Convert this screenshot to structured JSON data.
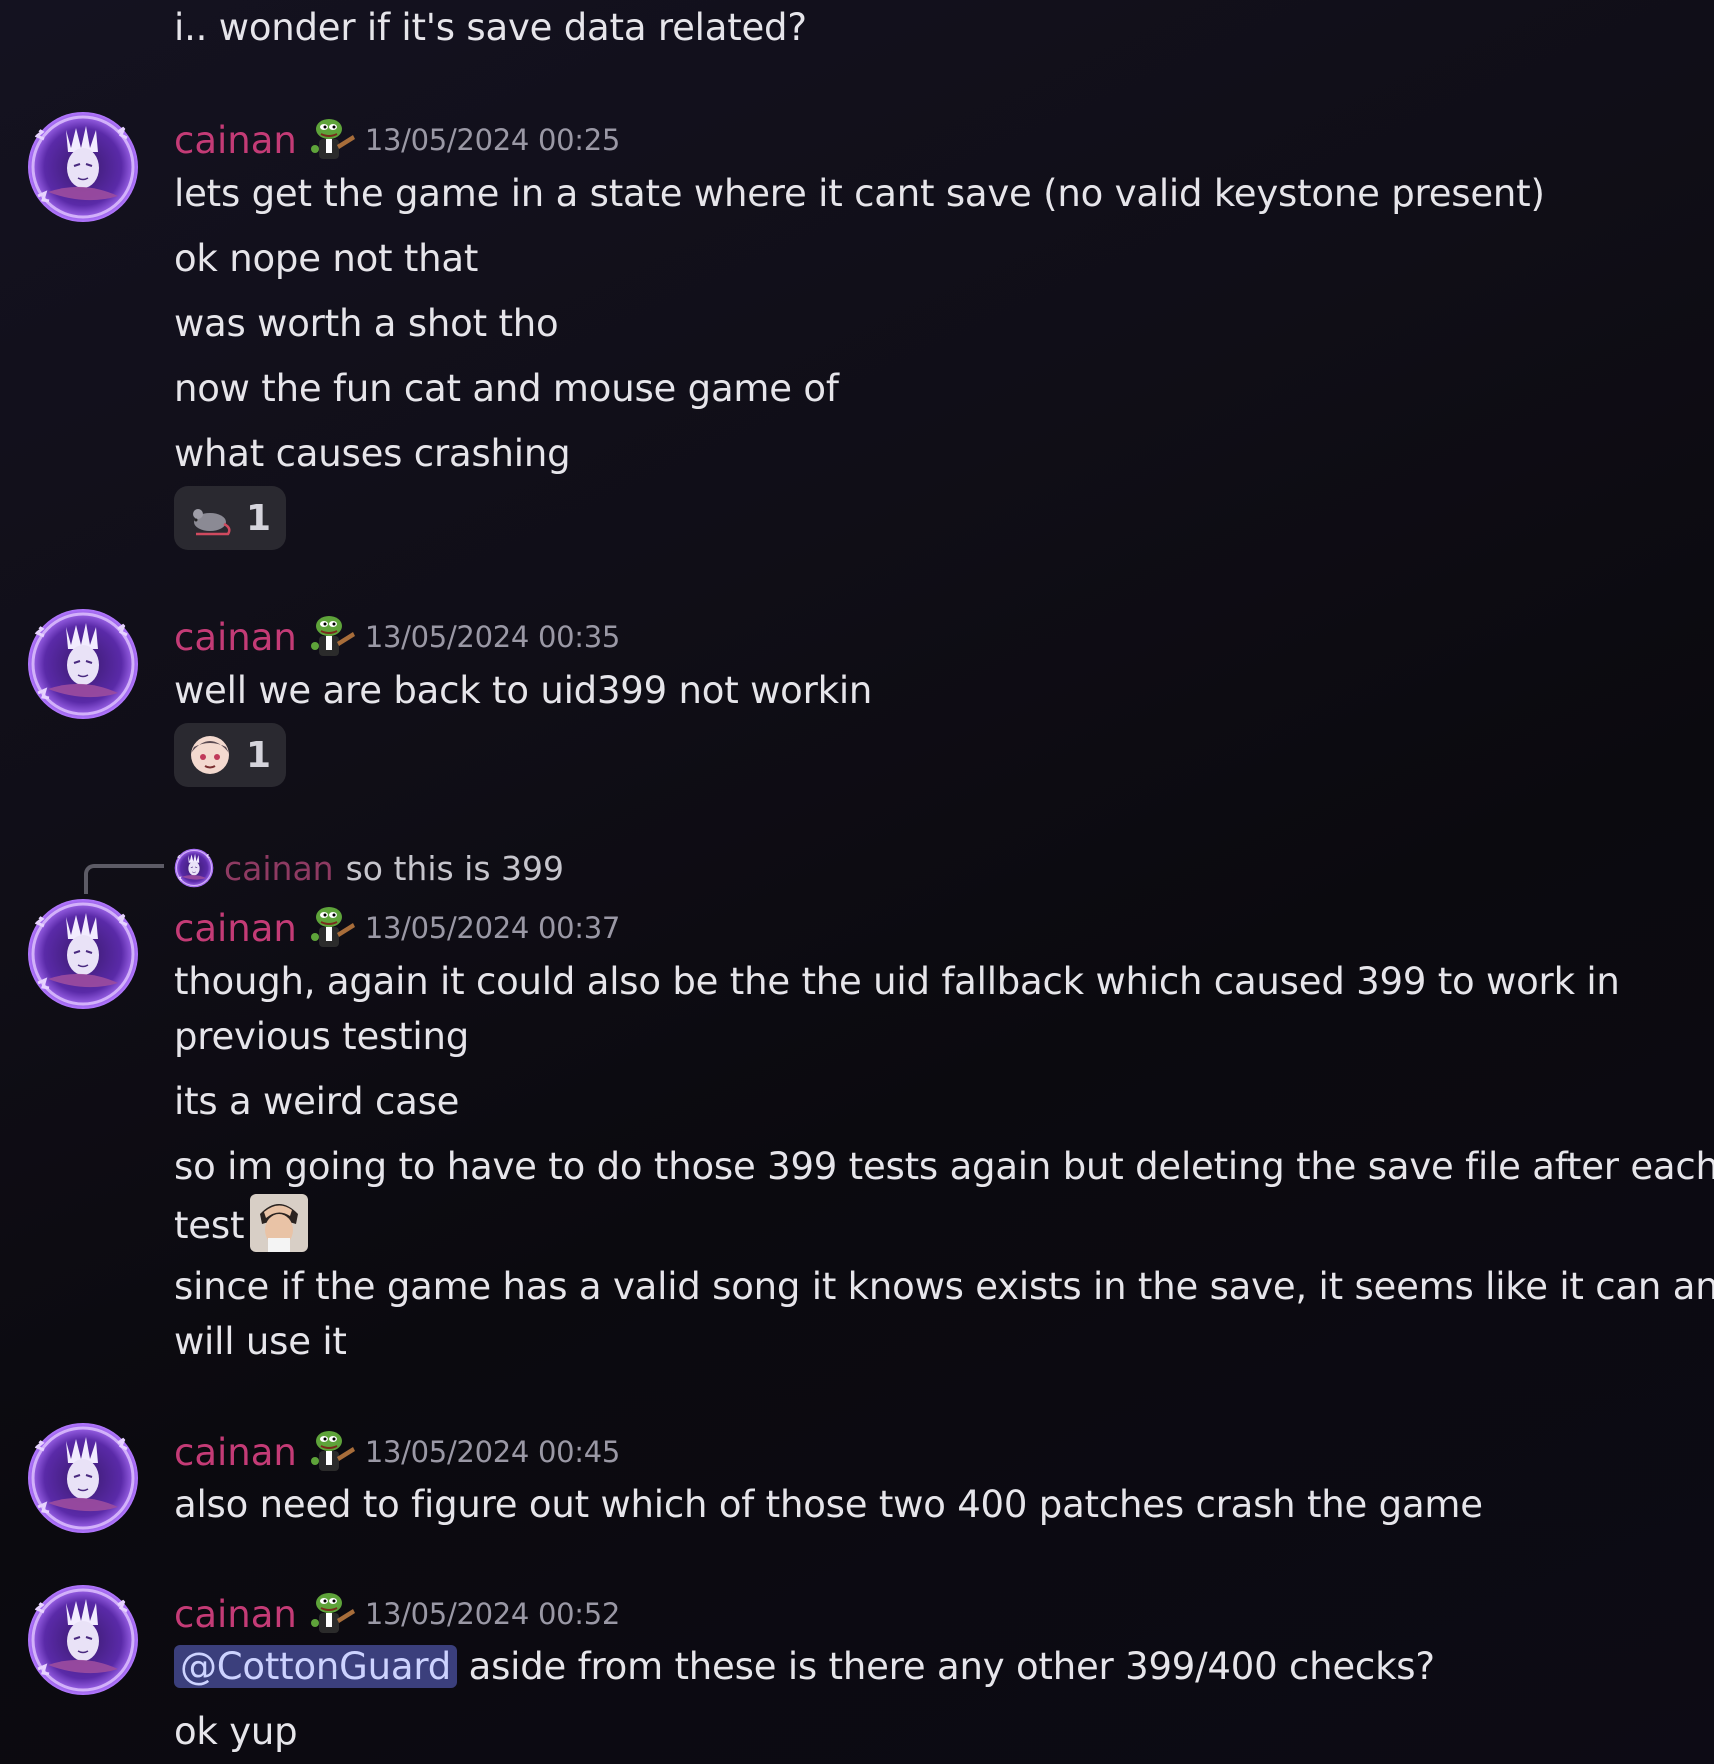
{
  "colors": {
    "background": "#0c0b10",
    "username": "#c43b76",
    "timestamp": "#9a98a5",
    "text": "#e6e5ea",
    "reaction_bg": "#2a2930",
    "mention_bg": "#3b3f7c"
  },
  "top_line": "i.. wonder if it's save data related?",
  "groups": [
    {
      "username": "cainan",
      "timestamp": "13/05/2024 00:25",
      "badge_icon": "pepe-role-badge-icon",
      "lines": [
        "lets get the game in a state where it cant save (no valid keystone present)",
        "ok nope not that",
        "was worth a shot tho",
        "now the fun cat and mouse game of",
        "what causes crashing"
      ],
      "reaction": {
        "emoji": "mouse-icon",
        "count": "1"
      }
    },
    {
      "username": "cainan",
      "timestamp": "13/05/2024 00:35",
      "badge_icon": "pepe-role-badge-icon",
      "lines": [
        "well we are back to uid399 not workin"
      ],
      "reaction": {
        "emoji": "anime-girl-icon",
        "count": "1"
      }
    },
    {
      "reply": {
        "username": "cainan",
        "text": "so this is 399"
      },
      "username": "cainan",
      "timestamp": "13/05/2024 00:37",
      "badge_icon": "pepe-role-badge-icon",
      "lines": [
        "though, again it could also be the the uid fallback which caused 399 to work in",
        "previous testing",
        "its a weird case",
        "so im going to have to do those 399 tests again but deleting the save file after each",
        "test",
        "since if the game has a valid song it knows exists in the save, it seems like it can and",
        "will use it"
      ],
      "inline_emoji": "facepalm-emoji-icon"
    },
    {
      "username": "cainan",
      "timestamp": "13/05/2024 00:45",
      "badge_icon": "pepe-role-badge-icon",
      "lines": [
        "also need to figure out which of those two 400 patches crash the game"
      ]
    },
    {
      "username": "cainan",
      "timestamp": "13/05/2024 00:52",
      "badge_icon": "pepe-role-badge-icon",
      "mention": "@CottonGuard",
      "lines": [
        " aside from these is there any other 399/400 checks?",
        "ok yup"
      ]
    }
  ]
}
